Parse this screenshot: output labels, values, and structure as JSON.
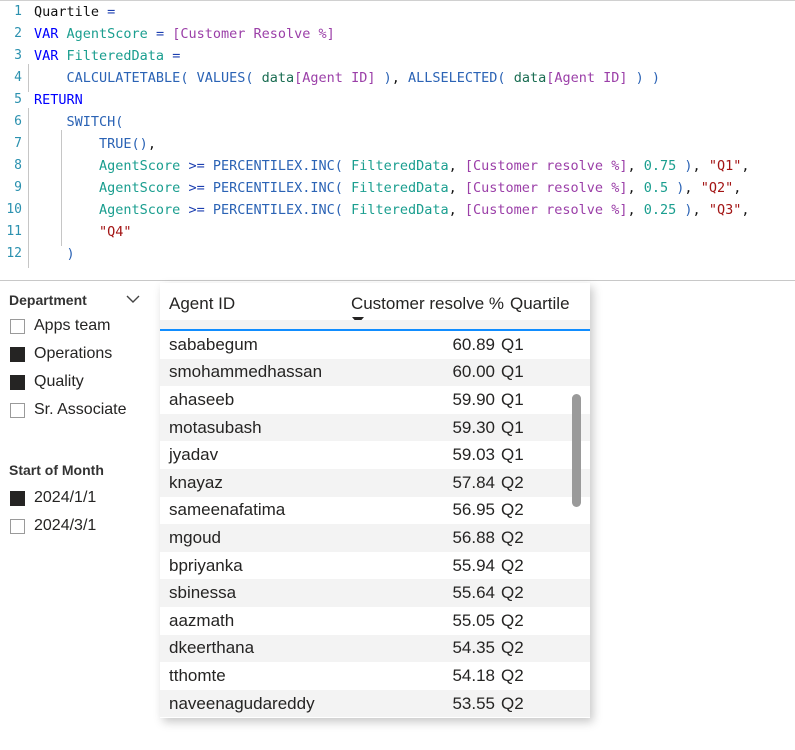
{
  "code_editor": {
    "language": "DAX",
    "lines": [
      {
        "n": "1",
        "indent_guides": 0
      },
      {
        "n": "2",
        "indent_guides": 0
      },
      {
        "n": "3",
        "indent_guides": 0
      },
      {
        "n": "4",
        "indent_guides": 1
      },
      {
        "n": "5",
        "indent_guides": 0
      },
      {
        "n": "6",
        "indent_guides": 1
      },
      {
        "n": "7",
        "indent_guides": 2
      },
      {
        "n": "8",
        "indent_guides": 2
      },
      {
        "n": "9",
        "indent_guides": 2
      },
      {
        "n": "10",
        "indent_guides": 2
      },
      {
        "n": "11",
        "indent_guides": 2
      },
      {
        "n": "12",
        "indent_guides": 1
      }
    ],
    "plain_text": [
      "Quartile =",
      "VAR AgentScore = [Customer Resolve %]",
      "VAR FilteredData =",
      "    CALCULATETABLE( VALUES( data[Agent ID] ), ALLSELECTED( data[Agent ID] ) )",
      "RETURN",
      "    SWITCH(",
      "        TRUE(),",
      "        AgentScore >= PERCENTILEX.INC( FilteredData, [Customer resolve %], 0.75 ), \"Q1\",",
      "        AgentScore >= PERCENTILEX.INC( FilteredData, [Customer resolve %], 0.5 ), \"Q2\",",
      "        AgentScore >= PERCENTILEX.INC( FilteredData, [Customer resolve %], 0.25 ), \"Q3\",",
      "        \"Q4\"",
      "    )"
    ],
    "tokens": {
      "measure_name": "Quartile",
      "keyword_var": "VAR",
      "keyword_return": "RETURN",
      "var_agentscore": "AgentScore",
      "var_filtereddata": "FilteredData",
      "col_customer_resolve_pct_cap": "[Customer Resolve %]",
      "col_customer_resolve_pct": "[Customer resolve %]",
      "fn_calculatetable": "CALCULATETABLE",
      "fn_values": "VALUES",
      "fn_allselected": "ALLSELECTED",
      "fn_switch": "SWITCH",
      "fn_true": "TRUE",
      "fn_percentilex_inc": "PERCENTILEX.INC",
      "tbl_data": "data",
      "col_agent_id": "[Agent ID]",
      "op_ge": ">=",
      "op_eq": "=",
      "num_075": "0.75",
      "num_05": "0.5",
      "num_025": "0.25",
      "str_q1": "\"Q1\"",
      "str_q2": "\"Q2\"",
      "str_q3": "\"Q3\"",
      "str_q4": "\"Q4\""
    },
    "colors": {
      "keyword": "#0000ff",
      "function": "#2b63b5",
      "variable": "#1a9e8f",
      "column": "#9b3fa8",
      "table": "#1a6d52",
      "number": "#1a9e8f",
      "string": "#a31515",
      "line_number": "#2b91af",
      "background": "#ffffff"
    }
  },
  "slicers": [
    {
      "id": "department",
      "title": "Department",
      "has_chevron": true,
      "items": [
        {
          "label": "Apps team",
          "checked": false
        },
        {
          "label": "Operations",
          "checked": true
        },
        {
          "label": "Quality",
          "checked": true
        },
        {
          "label": "Sr. Associate",
          "checked": false
        }
      ]
    },
    {
      "id": "start-of-month",
      "title": "Start of Month",
      "has_chevron": false,
      "items": [
        {
          "label": "2024/1/1",
          "checked": true
        },
        {
          "label": "2024/3/1",
          "checked": false
        }
      ]
    }
  ],
  "table_visual": {
    "columns": [
      {
        "key": "agent_id",
        "label": "Agent ID",
        "align": "left",
        "sorted": false
      },
      {
        "key": "score",
        "label": "Customer resolve %",
        "align": "right",
        "sorted": true,
        "sort_direction": "descending"
      },
      {
        "key": "quartile",
        "label": "Quartile",
        "align": "left",
        "sorted": false
      }
    ],
    "clipped_top_row": {
      "agent_id": "",
      "score": "",
      "quartile": ""
    },
    "rows": [
      {
        "agent_id": "sababegum",
        "score": "60.89",
        "quartile": "Q1"
      },
      {
        "agent_id": "smohammedhassan",
        "score": "60.00",
        "quartile": "Q1"
      },
      {
        "agent_id": "ahaseeb",
        "score": "59.90",
        "quartile": "Q1"
      },
      {
        "agent_id": "motasubash",
        "score": "59.30",
        "quartile": "Q1"
      },
      {
        "agent_id": "jyadav",
        "score": "59.03",
        "quartile": "Q1"
      },
      {
        "agent_id": "knayaz",
        "score": "57.84",
        "quartile": "Q2"
      },
      {
        "agent_id": "sameenafatima",
        "score": "56.95",
        "quartile": "Q2"
      },
      {
        "agent_id": "mgoud",
        "score": "56.88",
        "quartile": "Q2"
      },
      {
        "agent_id": "bpriyanka",
        "score": "55.94",
        "quartile": "Q2"
      },
      {
        "agent_id": "sbinessa",
        "score": "55.64",
        "quartile": "Q2"
      },
      {
        "agent_id": "aazmath",
        "score": "55.05",
        "quartile": "Q2"
      },
      {
        "agent_id": "dkeerthana",
        "score": "54.35",
        "quartile": "Q2"
      },
      {
        "agent_id": "tthomte",
        "score": "54.18",
        "quartile": "Q2"
      },
      {
        "agent_id": "naveenagudareddy",
        "score": "53.55",
        "quartile": "Q2"
      }
    ],
    "accent_color": "#118dff",
    "alt_row_color": "#f3f3f3",
    "scrollbar": {
      "visible": true,
      "thumb_color": "#9a9a9a"
    }
  }
}
